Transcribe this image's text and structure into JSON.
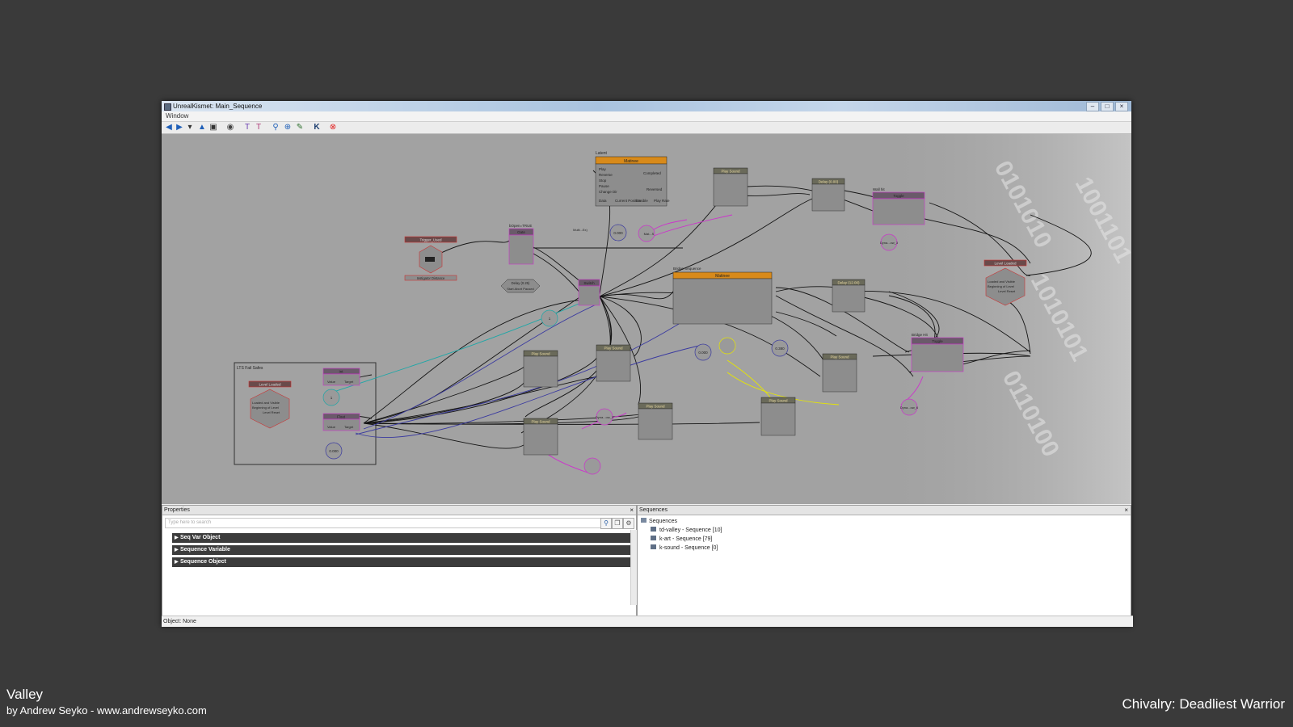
{
  "window": {
    "title": "UnrealKismet: Main_Sequence",
    "menu": [
      "Window"
    ],
    "controls": [
      "minimize",
      "maximize",
      "close"
    ]
  },
  "toolbar": {
    "icons": [
      "back-arrow-icon",
      "forward-arrow-icon",
      "dropdown-icon",
      "open-parent-icon",
      "parent-sequence-icon",
      "hide-icon",
      "text-search-icon",
      "text-filter-icon",
      "search-icon",
      "zoom-icon",
      "tag-icon",
      "kismet-k-icon",
      "stop-icon"
    ]
  },
  "nodes": {
    "latent": {
      "header": "Latent",
      "title": "Matinee",
      "ports": [
        "Play",
        "Reverse",
        "Stop",
        "Pause",
        "Change Dir"
      ],
      "out_ports": [
        "Completed",
        "Reversed"
      ],
      "vars": [
        "Data",
        "Current Position",
        "Ensible",
        "Play Rate"
      ]
    },
    "play_sound_1": {
      "title": "Play Sound"
    },
    "delay_1": {
      "title": "Delay (0.00)"
    },
    "wall_hit": {
      "header": "Wall hit",
      "title": "Toggle"
    },
    "trigger_used": {
      "title": "Trigger_Used",
      "footer": "Instigator  Distance"
    },
    "gate": {
      "header": "bOpen=TRUE",
      "title": "Gate"
    },
    "delay_small": {
      "title": "Delay (0.25)",
      "ports": "Start  Abort  Paused"
    },
    "switch": {
      "title": "Switch"
    },
    "matinee_2": {
      "header": "Bridge Sequence",
      "title": "Matinee"
    },
    "delay_2": {
      "title": "Delay (12.00)"
    },
    "level_loaded_right": {
      "title": "Level Loaded",
      "lines": [
        "Loaded and Visible",
        "Beginning of Level",
        "Level Reset"
      ]
    },
    "bridge_hit": {
      "header": "Bridge Hit",
      "title": "Toggle"
    },
    "group": {
      "title": "LTS Fail Safes"
    },
    "level_loaded_left": {
      "title": "Level Loaded",
      "lines": [
        "Loaded and Visible",
        "Beginning of Level",
        "Level Reset"
      ]
    },
    "int": {
      "title": "Int",
      "vars": [
        "Value",
        "Target"
      ]
    },
    "float": {
      "title": "Float",
      "vars": [
        "Value",
        "Target"
      ]
    },
    "play_sound_2": {
      "title": "Play Sound"
    },
    "play_sound_3": {
      "title": "Play Sound"
    },
    "play_sound_4": {
      "title": "Play Sound"
    },
    "play_sound_5": {
      "title": "Play Sound"
    },
    "play_sound_6": {
      "title": "Play Sound"
    },
    "play_sound_7": {
      "title": "Play Sound"
    },
    "var_values": {
      "v1": "0.000",
      "v2": "1",
      "v3": "0.000",
      "v4": "0.380",
      "v5": "0.000",
      "v6": "1"
    },
    "var_labels": {
      "l1": "Multi...Ex)",
      "l2": "Dyna...ow_3",
      "l3": "Mat...S",
      "l4": "Dyna...ow_6",
      "l5": "Dyna...ow_3"
    }
  },
  "properties": {
    "title": "Properties",
    "search_placeholder": "Type here to search",
    "categories": [
      "Seq Var Object",
      "Sequence Variable",
      "Sequence Object"
    ]
  },
  "sequences": {
    "title": "Sequences",
    "root": "Sequences",
    "items": [
      "td-valley - Sequence [10]",
      "k-art - Sequence [79]",
      "k-sound - Sequence [0]"
    ]
  },
  "status": {
    "text": "Object: None"
  },
  "caption": {
    "title": "Valley",
    "byline": "by Andrew Seyko - www.andrewseyko.com",
    "game": "Chivalry: Deadliest Warrior"
  },
  "colors": {
    "background": "#3a3a3a",
    "canvas": "#a2a2a2",
    "matinee_header": "#d88a1a",
    "seq_header": "#6a6a5a",
    "link": "#111111",
    "var_link": "#cc33cc"
  }
}
